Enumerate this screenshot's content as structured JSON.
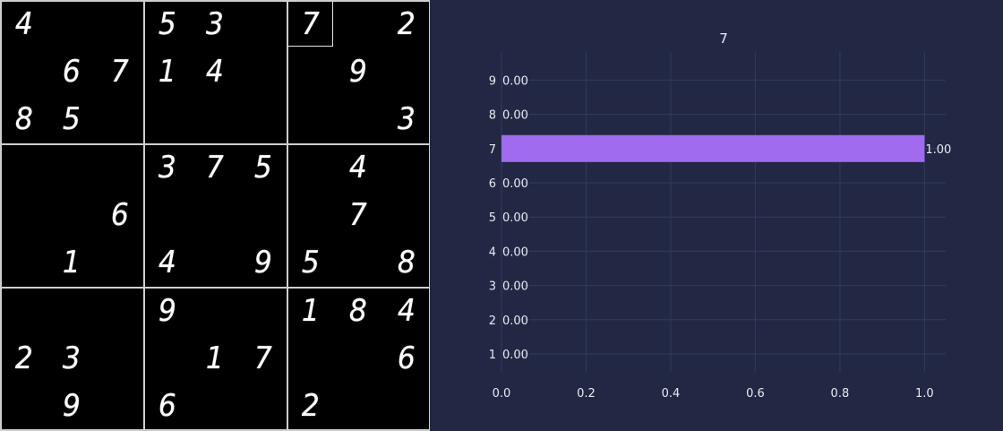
{
  "board": {
    "selected": {
      "row": 0,
      "col": 6
    },
    "cells": [
      [
        4,
        null,
        null,
        5,
        3,
        null,
        7,
        null,
        2
      ],
      [
        null,
        6,
        7,
        1,
        4,
        null,
        null,
        9,
        null
      ],
      [
        8,
        5,
        null,
        null,
        null,
        null,
        null,
        null,
        3
      ],
      [
        null,
        null,
        null,
        3,
        7,
        5,
        null,
        4,
        null
      ],
      [
        null,
        null,
        6,
        null,
        null,
        null,
        null,
        7,
        null
      ],
      [
        null,
        1,
        null,
        4,
        null,
        9,
        5,
        null,
        8
      ],
      [
        null,
        null,
        null,
        9,
        null,
        null,
        1,
        8,
        4
      ],
      [
        2,
        3,
        null,
        null,
        1,
        7,
        null,
        null,
        6
      ],
      [
        null,
        9,
        null,
        6,
        null,
        null,
        2,
        null,
        null
      ]
    ]
  },
  "chart_data": {
    "type": "bar",
    "orientation": "horizontal",
    "title": "7",
    "categories": [
      "1",
      "2",
      "3",
      "4",
      "5",
      "6",
      "7",
      "8",
      "9"
    ],
    "values": [
      0.0,
      0.0,
      0.0,
      0.0,
      0.0,
      0.0,
      1.0,
      0.0,
      0.0
    ],
    "value_labels": [
      "0.00",
      "0.00",
      "0.00",
      "0.00",
      "0.00",
      "0.00",
      "1.00",
      "0.00",
      "0.00"
    ],
    "xlim": [
      0,
      1.05
    ],
    "xticks": [
      "0.0",
      "0.2",
      "0.4",
      "0.6",
      "0.8",
      "1.0"
    ],
    "xtick_values": [
      0,
      0.2,
      0.4,
      0.6,
      0.8,
      1.0
    ],
    "grid": true,
    "bar_color": "#a16bf0",
    "background": "#222844",
    "grid_color": "#323a5c"
  }
}
